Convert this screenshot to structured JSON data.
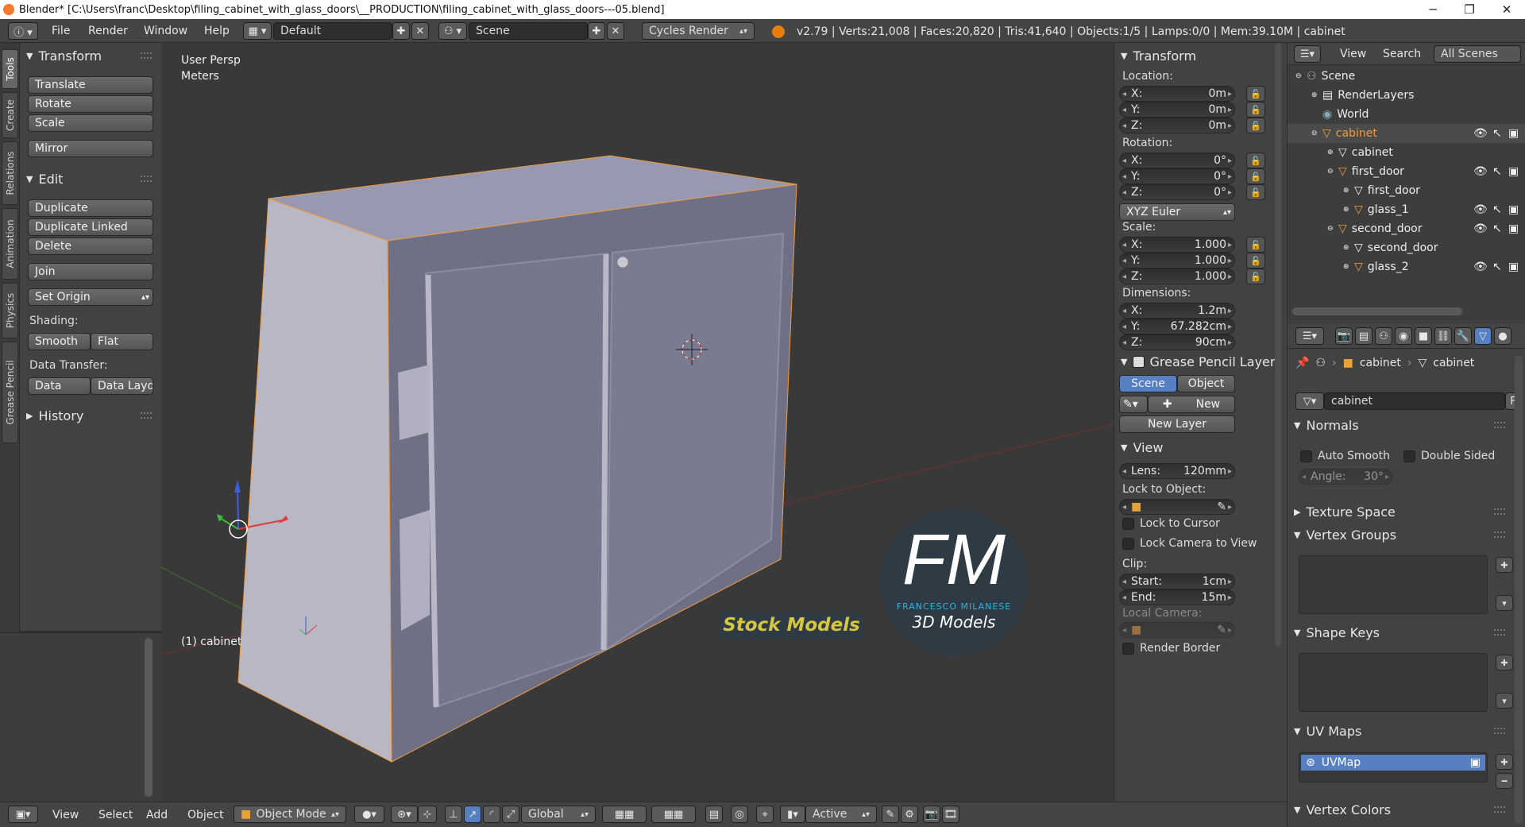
{
  "titlebar": {
    "title": "Blender* [C:\\Users\\franc\\Desktop\\filing_cabinet_with_glass_doors\\__PRODUCTION\\filing_cabinet_with_glass_doors---05.blend]"
  },
  "infobar": {
    "menus": [
      "File",
      "Render",
      "Window",
      "Help"
    ],
    "screen_layout": "Default",
    "scene": "Scene",
    "engine": "Cycles Render",
    "stats": "v2.79 | Verts:21,008 | Faces:20,820 | Tris:41,640 | Objects:1/5 | Lamps:0/0 | Mem:39.10M | cabinet"
  },
  "vtabs": [
    "Tools",
    "Create",
    "Relations",
    "Animation",
    "Physics",
    "Grease Pencil"
  ],
  "toolshelf": {
    "transform": {
      "title": "Transform",
      "buttons": [
        "Translate",
        "Rotate",
        "Scale",
        "Mirror"
      ]
    },
    "edit": {
      "title": "Edit",
      "buttons": [
        "Duplicate",
        "Duplicate Linked",
        "Delete",
        "Join",
        "Set Origin"
      ]
    },
    "shading_label": "Shading:",
    "shading_buttons": [
      "Smooth",
      "Flat"
    ],
    "data_transfer_label": "Data Transfer:",
    "data_buttons": [
      "Data",
      "Data Layo"
    ],
    "history": "History"
  },
  "viewport": {
    "view_name": "User Persp",
    "units": "Meters",
    "object_label": "(1) cabinet",
    "watermark_logo": "FM",
    "watermark_name": "FRANCESCO MILANESE",
    "watermark_sub": "3D Models",
    "watermark_stock": "Stock Models"
  },
  "npanel": {
    "transform_title": "Transform",
    "location_label": "Location:",
    "location": [
      {
        "axis": "X:",
        "value": "0m"
      },
      {
        "axis": "Y:",
        "value": "0m"
      },
      {
        "axis": "Z:",
        "value": "0m"
      }
    ],
    "rotation_label": "Rotation:",
    "rotation": [
      {
        "axis": "X:",
        "value": "0°"
      },
      {
        "axis": "Y:",
        "value": "0°"
      },
      {
        "axis": "Z:",
        "value": "0°"
      }
    ],
    "rotation_mode": "XYZ Euler",
    "scale_label": "Scale:",
    "scale": [
      {
        "axis": "X:",
        "value": "1.000"
      },
      {
        "axis": "Y:",
        "value": "1.000"
      },
      {
        "axis": "Z:",
        "value": "1.000"
      }
    ],
    "dimensions_label": "Dimensions:",
    "dimensions": [
      {
        "axis": "X:",
        "value": "1.2m"
      },
      {
        "axis": "Y:",
        "value": "67.282cm"
      },
      {
        "axis": "Z:",
        "value": "90cm"
      }
    ],
    "grease_pencil_title": "Grease Pencil Layer",
    "gp_scene": "Scene",
    "gp_object": "Object",
    "gp_new": "New",
    "gp_new_layer": "New Layer",
    "view_title": "View",
    "lens_label": "Lens:",
    "lens_value": "120mm",
    "lock_to_object": "Lock to Object:",
    "lock_to_cursor": "Lock to Cursor",
    "lock_camera": "Lock Camera to View",
    "clip_label": "Clip:",
    "clip_start_label": "Start:",
    "clip_start": "1cm",
    "clip_end_label": "End:",
    "clip_end": "15m",
    "local_camera": "Local Camera:",
    "render_border": "Render Border"
  },
  "outliner": {
    "view": "View",
    "search": "Search",
    "filter": "All Scenes",
    "rows": [
      "Scene",
      "RenderLayers",
      "World",
      "cabinet",
      "cabinet",
      "first_door",
      "first_door",
      "glass_1",
      "second_door",
      "second_door",
      "glass_2"
    ]
  },
  "properties": {
    "breadcrumb_object": "cabinet",
    "breadcrumb_data": "cabinet",
    "mesh_name": "cabinet",
    "fake_user": "F",
    "normals": "Normals",
    "auto_smooth": "Auto Smooth",
    "double_sided": "Double Sided",
    "angle_label": "Angle:",
    "angle_value": "30°",
    "texture_space": "Texture Space",
    "vertex_groups": "Vertex Groups",
    "shape_keys": "Shape Keys",
    "uv_maps": "UV Maps",
    "uv_map_item": "UVMap",
    "vertex_colors": "Vertex Colors"
  },
  "bottombar": {
    "menus": [
      "View",
      "Select",
      "Add",
      "Object"
    ],
    "mode": "Object Mode",
    "orientation": "Global",
    "pivot": "Active"
  },
  "colors": {
    "selection": "#f29c3f",
    "accent_blue": "#5680c2",
    "watermark_cyan": "#2ab3e6",
    "watermark_yellow": "#d6c640"
  }
}
